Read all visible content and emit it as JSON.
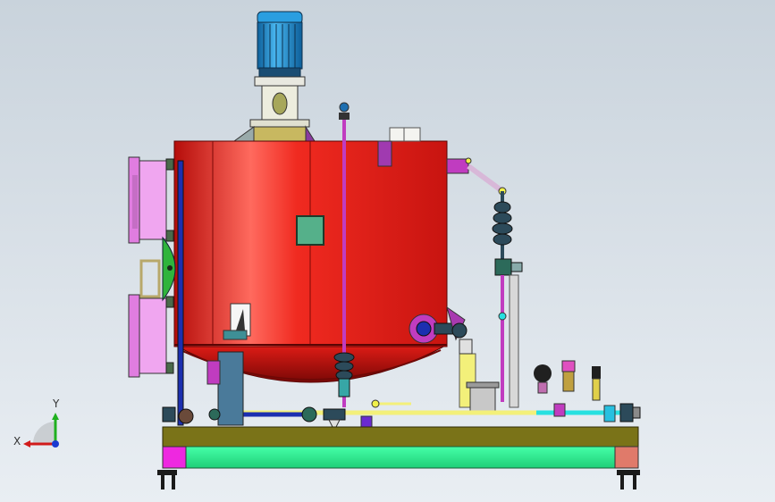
{
  "viewport": {
    "background_top": "#c9d3dc",
    "background_bottom": "#e9eef3"
  },
  "triad": {
    "x_label": "X",
    "y_label": "Y",
    "x_color": "#d11a1a",
    "y_color": "#1fb01f",
    "z_color": "#1a3ad1"
  },
  "colors": {
    "tank": "#e8201a",
    "tank_shadow": "#a50f0b",
    "motor": "#1e8fd0",
    "skid_top": "#6e6a14",
    "skid_rail": "#27f08f",
    "pipe_yellow": "#f3f07a",
    "pipe_purple": "#c03cc0",
    "pipe_cyan": "#27e0e0",
    "pipe_blue": "#1c2fb0",
    "pink_panel": "#f0a6f0",
    "green_gauge": "#2fb43c"
  }
}
